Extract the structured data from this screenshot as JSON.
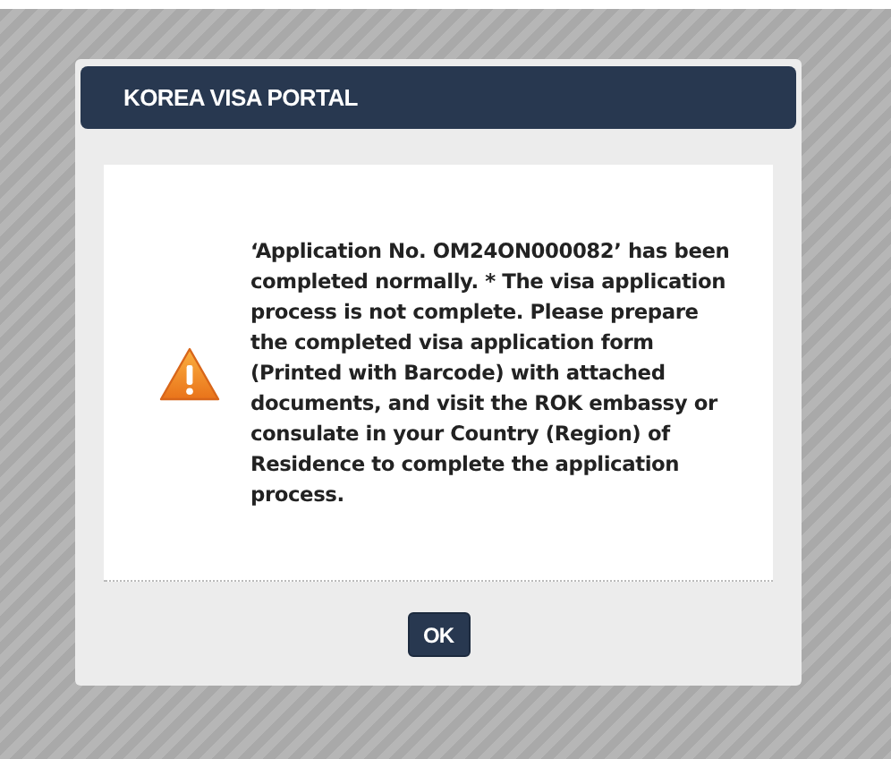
{
  "dialog": {
    "title": "KOREA VISA PORTAL",
    "message": "‘Application No. OM24ON000082’ has been completed normally. * The visa application process is not complete. Please prepare the completed visa application form (Printed with Barcode) with attached documents, and visit the ROK embassy or consulate in your Country (Region) of Residence to complete the application process.",
    "kind": "warning",
    "buttons": [
      "OK"
    ]
  }
}
